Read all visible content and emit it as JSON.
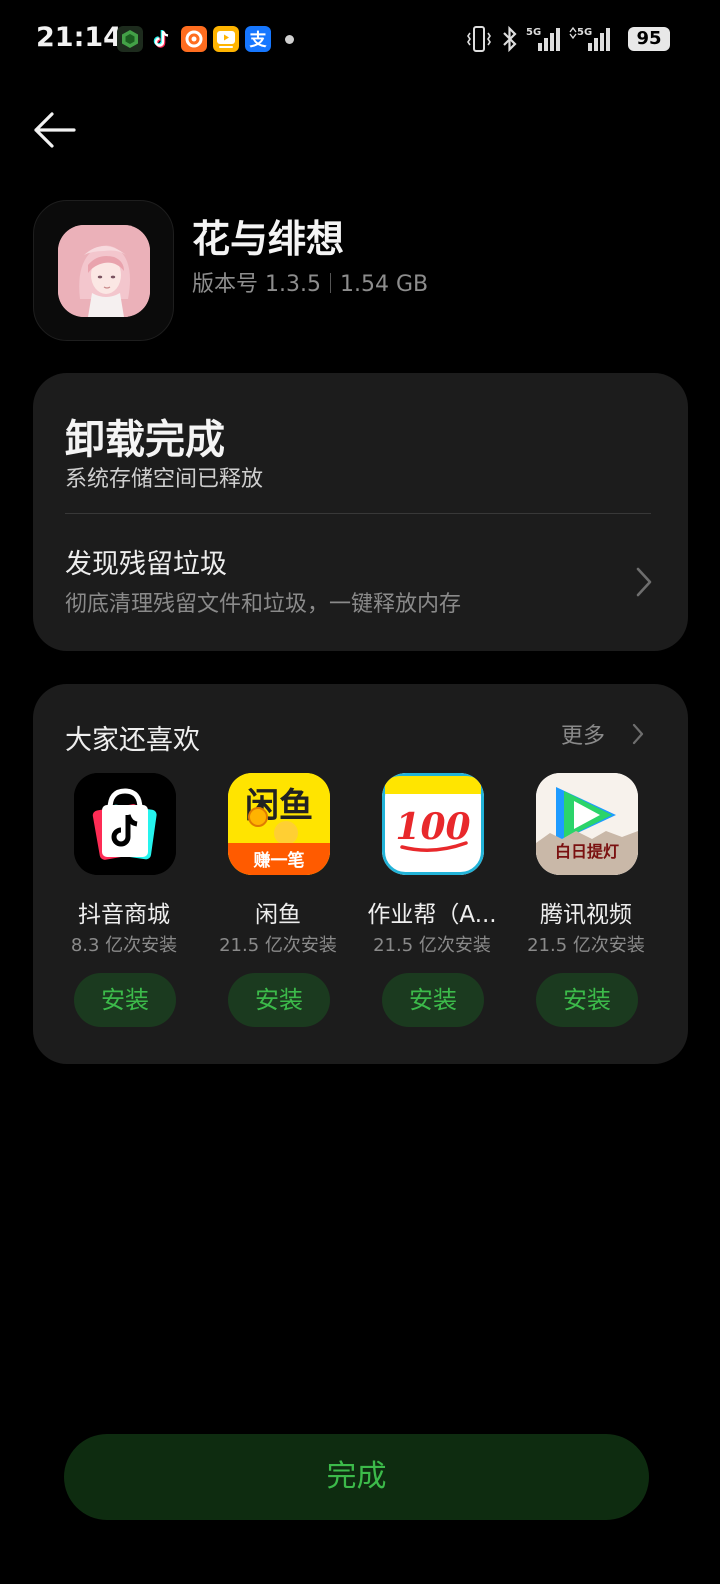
{
  "status_bar": {
    "time": "21:14",
    "notification_icons": [
      "security-app-icon",
      "douyin-icon",
      "app-icon-orange",
      "video-app-icon",
      "alipay-icon"
    ],
    "signal_1": "5G",
    "signal_2": "5G",
    "battery": "95"
  },
  "app": {
    "name": "花与绯想",
    "version": "版本号 1.3.5",
    "size": "1.54 GB"
  },
  "uninstall_card": {
    "title": "卸载完成",
    "subtitle": "系统存储空间已释放",
    "junk_title": "发现残留垃圾",
    "junk_subtitle": "彻底清理残留文件和垃圾，一键释放内存"
  },
  "recommend": {
    "title": "大家还喜欢",
    "more_label": "更多",
    "apps": [
      {
        "name": "抖音商城",
        "installs": "8.3 亿次安装",
        "button": "安装",
        "icon": "douyin-mall-icon"
      },
      {
        "name": "闲鱼",
        "installs": "21.5 亿次安装",
        "button": "安装",
        "icon": "xianyu-icon",
        "icon_text_top": "闲鱼",
        "icon_text_bottom": "赚一笔"
      },
      {
        "name": "作业帮（A...",
        "installs": "21.5 亿次安装",
        "button": "安装",
        "icon": "zuoyebang-icon",
        "icon_text": "100"
      },
      {
        "name": "腾讯视频",
        "installs": "21.5 亿次安装",
        "button": "安装",
        "icon": "tencent-video-icon",
        "icon_text": "白日提灯"
      }
    ]
  },
  "footer": {
    "done_label": "完成"
  },
  "colors": {
    "background": "#000000",
    "card": "#1c1c1c",
    "accent_green": "#3cba4a",
    "button_green_bg": "#1b3a1f",
    "done_button_bg": "#0e2c10"
  }
}
